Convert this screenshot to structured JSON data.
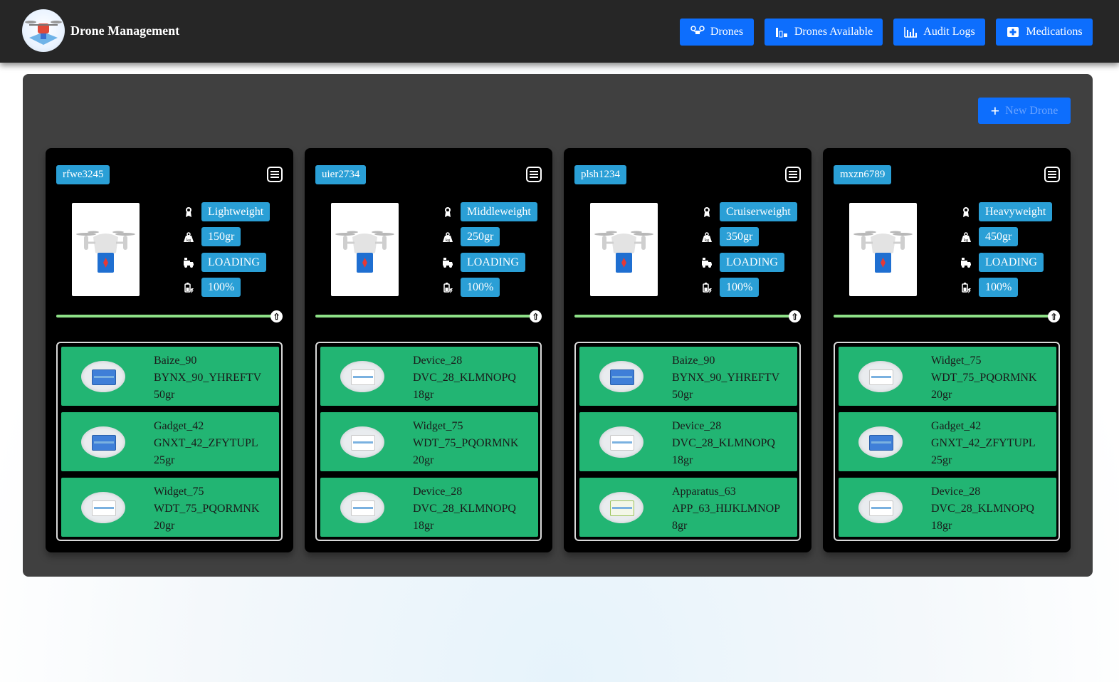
{
  "header": {
    "brand": "Drone Management",
    "nav": [
      {
        "label": "Drones",
        "icon": "drone-icon"
      },
      {
        "label": "Drones Available",
        "icon": "drones-available-icon"
      },
      {
        "label": "Audit Logs",
        "icon": "chart-icon"
      },
      {
        "label": "Medications",
        "icon": "medical-kit-icon"
      }
    ]
  },
  "actions": {
    "new_drone": "New Drone"
  },
  "colors": {
    "accent": "#0d6efd",
    "pill": "#2a9fd6",
    "medication_bg": "#22b573",
    "progress": "#8ee087"
  },
  "drones": [
    {
      "serial": "rfwe3245",
      "model": "Lightweight",
      "weight": "150gr",
      "state": "LOADING",
      "battery": "100%",
      "battery_level": 1.0,
      "medications": [
        {
          "name": "Baize_90",
          "code": "BYNX_90_YHREFTV",
          "weight": "50gr",
          "image": "blue-boxes"
        },
        {
          "name": "Gadget_42",
          "code": "GNXT_42_ZFYTUPL",
          "weight": "25gr",
          "image": "blue-box"
        },
        {
          "name": "Widget_75",
          "code": "WDT_75_PQORMNK",
          "weight": "20gr",
          "image": "white-box"
        }
      ]
    },
    {
      "serial": "uier2734",
      "model": "Middleweight",
      "weight": "250gr",
      "state": "LOADING",
      "battery": "100%",
      "battery_level": 1.0,
      "medications": [
        {
          "name": "Device_28",
          "code": "DVC_28_KLMNOPQ",
          "weight": "18gr",
          "image": "white-box"
        },
        {
          "name": "Widget_75",
          "code": "WDT_75_PQORMNK",
          "weight": "20gr",
          "image": "white-box"
        },
        {
          "name": "Device_28",
          "code": "DVC_28_KLMNOPQ",
          "weight": "18gr",
          "image": "white-box"
        }
      ]
    },
    {
      "serial": "plsh1234",
      "model": "Cruiserweight",
      "weight": "350gr",
      "state": "LOADING",
      "battery": "100%",
      "battery_level": 1.0,
      "medications": [
        {
          "name": "Baize_90",
          "code": "BYNX_90_YHREFTV",
          "weight": "50gr",
          "image": "blue-boxes"
        },
        {
          "name": "Device_28",
          "code": "DVC_28_KLMNOPQ",
          "weight": "18gr",
          "image": "white-box"
        },
        {
          "name": "Apparatus_63",
          "code": "APP_63_HIJKLMNOP",
          "weight": "8gr",
          "image": "green-box"
        }
      ]
    },
    {
      "serial": "mxzn6789",
      "model": "Heavyweight",
      "weight": "450gr",
      "state": "LOADING",
      "battery": "100%",
      "battery_level": 1.0,
      "medications": [
        {
          "name": "Widget_75",
          "code": "WDT_75_PQORMNK",
          "weight": "20gr",
          "image": "white-box"
        },
        {
          "name": "Gadget_42",
          "code": "GNXT_42_ZFYTUPL",
          "weight": "25gr",
          "image": "blue-box"
        },
        {
          "name": "Device_28",
          "code": "DVC_28_KLMNOPQ",
          "weight": "18gr",
          "image": "white-box"
        }
      ]
    }
  ]
}
